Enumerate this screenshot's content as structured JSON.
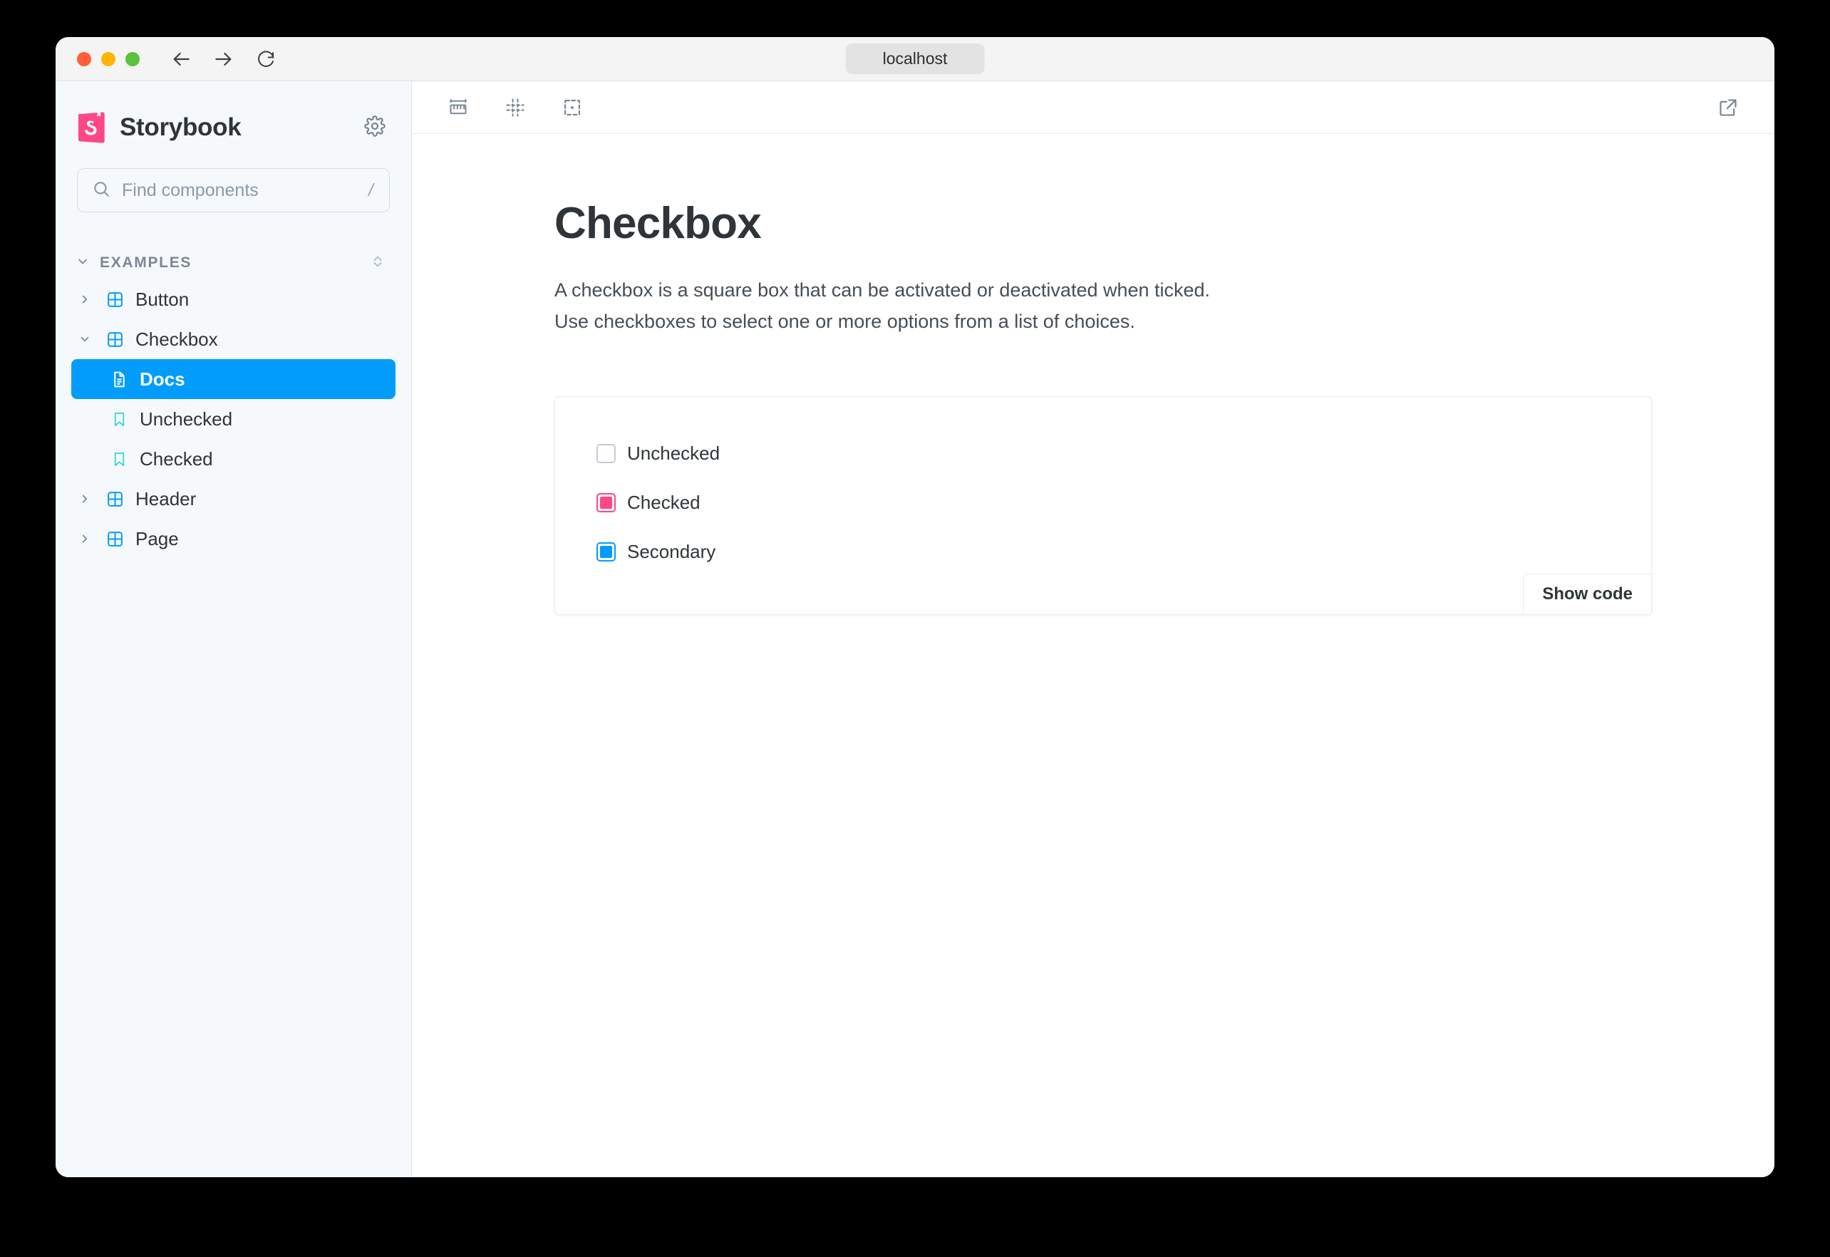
{
  "browser": {
    "url": "localhost",
    "back_label": "Back",
    "forward_label": "Forward",
    "reload_label": "Reload"
  },
  "sidebar": {
    "brand": "Storybook",
    "settings_label": "Settings",
    "search": {
      "placeholder": "Find components",
      "value": "",
      "shortcut": "/"
    },
    "section": {
      "label": "EXAMPLES",
      "expand_label": "Expand all"
    },
    "items": [
      {
        "label": "Button",
        "type": "component",
        "expanded": false,
        "selected": false
      },
      {
        "label": "Checkbox",
        "type": "component",
        "expanded": true,
        "selected": false
      },
      {
        "label": "Docs",
        "type": "docs",
        "selected": true
      },
      {
        "label": "Unchecked",
        "type": "story",
        "selected": false
      },
      {
        "label": "Checked",
        "type": "story",
        "selected": false
      },
      {
        "label": "Header",
        "type": "component",
        "expanded": false,
        "selected": false
      },
      {
        "label": "Page",
        "type": "component",
        "expanded": false,
        "selected": false
      }
    ]
  },
  "toolbar": {
    "measure_label": "Measure",
    "grid_label": "Grid",
    "outline_label": "Outline",
    "open_new_tab_label": "Open canvas in new tab"
  },
  "doc": {
    "title": "Checkbox",
    "description_line1": "A checkbox is a square box that can be activated or deactivated when ticked.",
    "description_line2": "Use checkboxes to select one or more options from a list of choices.",
    "show_code_label": "Show code",
    "checkboxes": [
      {
        "label": "Unchecked",
        "state": "unchecked",
        "color": "#c4ccd4"
      },
      {
        "label": "Checked",
        "state": "checked",
        "color": "#ff4785"
      },
      {
        "label": "Secondary",
        "state": "checked",
        "color": "#039bfd"
      }
    ]
  },
  "colors": {
    "accent_blue": "#029CFD",
    "brand_pink": "#FF4785",
    "sidebar_bg": "#F6F9FC"
  }
}
